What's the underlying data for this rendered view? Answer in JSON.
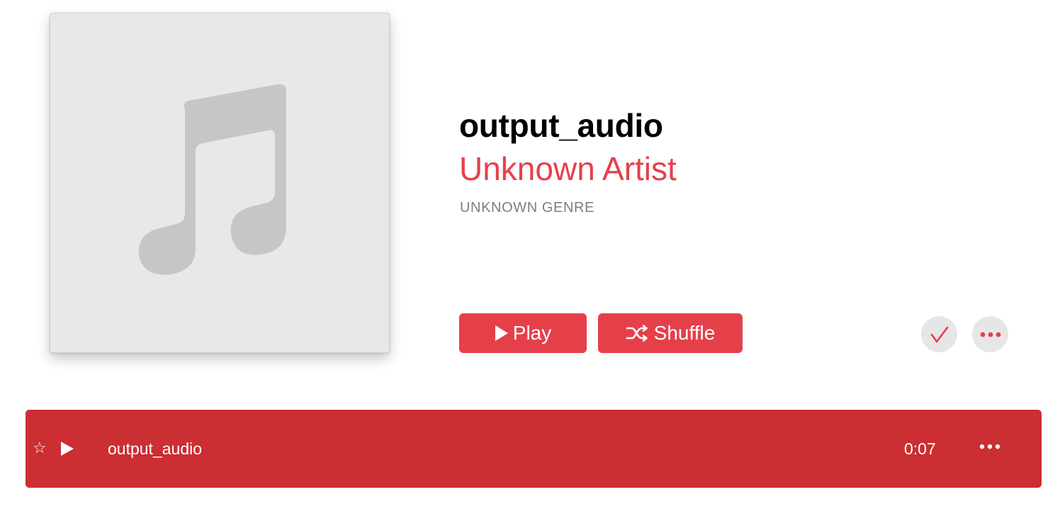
{
  "album": {
    "artwork_icon": "music-note-icon",
    "title": "output_audio",
    "artist": "Unknown Artist",
    "genre": "UNKNOWN GENRE"
  },
  "actions": {
    "play_label": "Play",
    "shuffle_label": "Shuffle",
    "check_icon": "checkmark-icon",
    "more_icon": "ellipsis-icon"
  },
  "tracks": [
    {
      "favorite_icon": "star-icon",
      "play_icon": "play-icon",
      "name": "output_audio",
      "duration": "0:07",
      "more_icon": "ellipsis-icon",
      "selected": true
    }
  ],
  "colors": {
    "accent": "#e5404a",
    "selected_row": "#cb2e33",
    "artwork_bg": "#e8e8e8",
    "note_gray": "#c6c6c6",
    "genre_gray": "#7d7d7d"
  }
}
